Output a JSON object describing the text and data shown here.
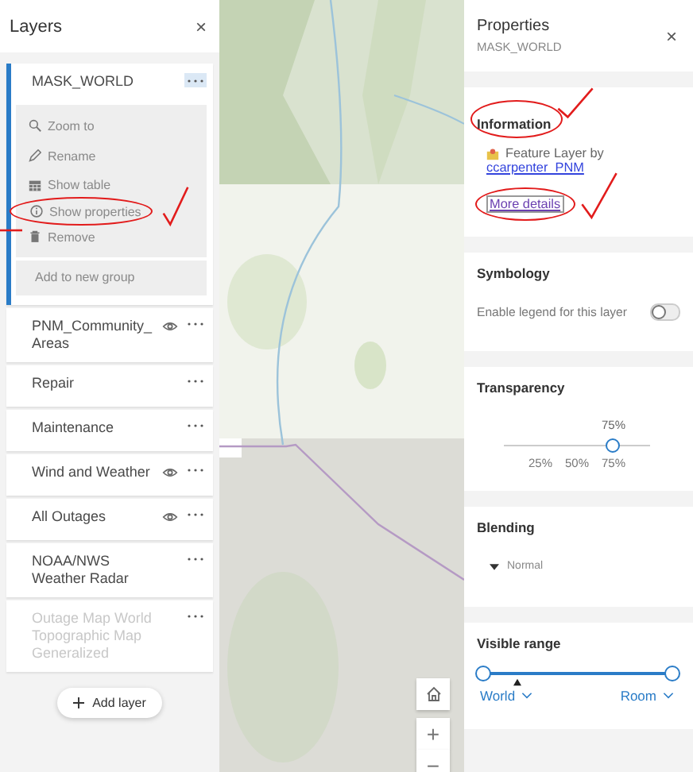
{
  "layers_panel": {
    "title": "Layers",
    "close": "×",
    "layers": [
      {
        "name": "MASK_WORLD",
        "selected": true,
        "expanded": true,
        "eye": false,
        "disabled": false
      },
      {
        "name": "PNM_Community_Areas",
        "selected": false,
        "expanded": false,
        "eye": true,
        "disabled": false
      },
      {
        "name": "Repair",
        "selected": false,
        "expanded": false,
        "eye": false,
        "disabled": false
      },
      {
        "name": "Maintenance",
        "selected": false,
        "expanded": false,
        "eye": false,
        "disabled": false
      },
      {
        "name": "Wind and Weather",
        "selected": false,
        "expanded": false,
        "eye": true,
        "disabled": false
      },
      {
        "name": "All Outages",
        "selected": false,
        "expanded": false,
        "eye": true,
        "disabled": false
      },
      {
        "name": "NOAA/NWS Weather Radar",
        "selected": false,
        "expanded": false,
        "eye": false,
        "disabled": false
      },
      {
        "name": "Outage Map World Topographic Map Generalized",
        "selected": false,
        "expanded": false,
        "eye": false,
        "disabled": true
      }
    ],
    "menu": [
      {
        "kind": "zoom",
        "label": "Zoom to"
      },
      {
        "kind": "rename",
        "label": "Rename"
      },
      {
        "kind": "table",
        "label": "Show table"
      },
      {
        "kind": "info",
        "label": "Show properties",
        "circled": true
      },
      {
        "kind": "remove",
        "label": "Remove"
      },
      {
        "kind": "group",
        "label": "Add to new group"
      }
    ],
    "add_button": "Add layer"
  },
  "map": {
    "kind": "picture",
    "controls": [
      {
        "kind": "home"
      },
      {
        "kind": "zoom_in",
        "label": "+"
      },
      {
        "kind": "zoom_out",
        "label": "−"
      }
    ]
  },
  "properties_panel": {
    "title": "Properties",
    "subtitle": "MASK_WORLD",
    "close": "×",
    "information": {
      "title": "Information",
      "title_circled": true,
      "source_text": "Feature Layer by",
      "owner_link": "ccarpenter_PNM",
      "details_link": "More details",
      "details_circled": true
    },
    "symbology": {
      "title": "Symbology",
      "legend_label": "Enable legend for this layer",
      "legend_on": false
    },
    "transparency": {
      "title": "Transparency",
      "value": "75%",
      "level": 0.75,
      "ticks": [
        "25%",
        "50%",
        "75%"
      ]
    },
    "blending": {
      "title": "Blending",
      "mode": "Normal"
    },
    "visible_range": {
      "title": "Visible range",
      "thumbs": [
        {
          "level": 0
        },
        {
          "level": 1
        }
      ],
      "current": {
        "level": 0.18
      },
      "min_label": "World",
      "max_label": "Room"
    }
  },
  "annotations": [
    {
      "kind": "check"
    },
    {
      "kind": "line"
    },
    {
      "kind": "check"
    },
    {
      "kind": "check"
    }
  ]
}
